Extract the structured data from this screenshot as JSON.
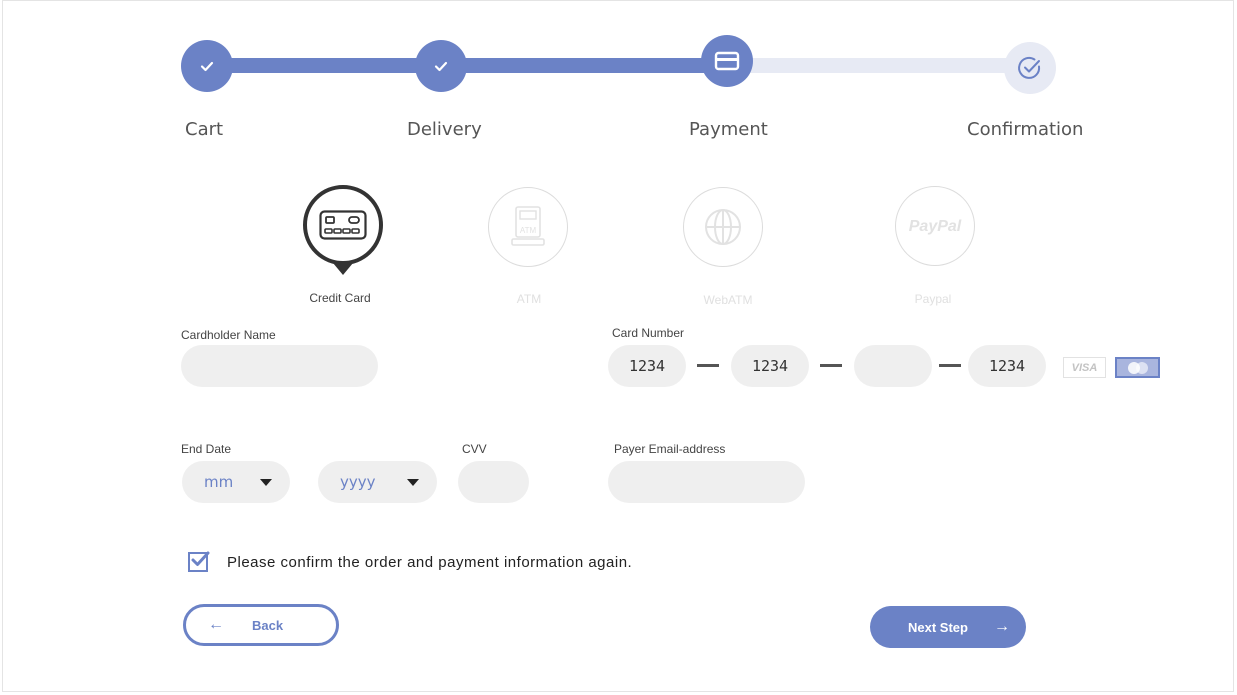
{
  "stepper": {
    "steps": [
      {
        "label": "Cart",
        "status": "done",
        "icon": "check-icon"
      },
      {
        "label": "Delivery",
        "status": "done",
        "icon": "check-icon"
      },
      {
        "label": "Payment",
        "status": "active",
        "icon": "credit-card-icon"
      },
      {
        "label": "Confirmation",
        "status": "todo",
        "icon": "check-circle-icon"
      }
    ]
  },
  "payment_methods": [
    {
      "label": "Credit Card",
      "selected": true,
      "icon": "credit-card-icon"
    },
    {
      "label": "ATM",
      "selected": false,
      "icon": "atm-icon"
    },
    {
      "label": "WebATM",
      "selected": false,
      "icon": "globe-icon"
    },
    {
      "label": "Paypal",
      "selected": false,
      "icon": "paypal-logo",
      "logo_text": "PayPal"
    }
  ],
  "form": {
    "cardholder_name": {
      "label": "Cardholder Name",
      "value": ""
    },
    "card_number": {
      "label": "Card Number",
      "segments": [
        "1234",
        "1234",
        "",
        "1234"
      ]
    },
    "card_brands": [
      "VISA",
      "MasterCard"
    ],
    "end_date": {
      "label": "End Date",
      "month": "mm",
      "year": "yyyy"
    },
    "cvv": {
      "label": "CVV",
      "value": ""
    },
    "payer_email": {
      "label": "Payer Email-address",
      "value": ""
    }
  },
  "confirm": {
    "checked": true,
    "text": "Please confirm the order and payment information again."
  },
  "buttons": {
    "back": "Back",
    "next": "Next Step"
  },
  "colors": {
    "accent": "#6b82c6",
    "track_inactive": "#e7eaf4",
    "field_bg": "#efefef"
  }
}
